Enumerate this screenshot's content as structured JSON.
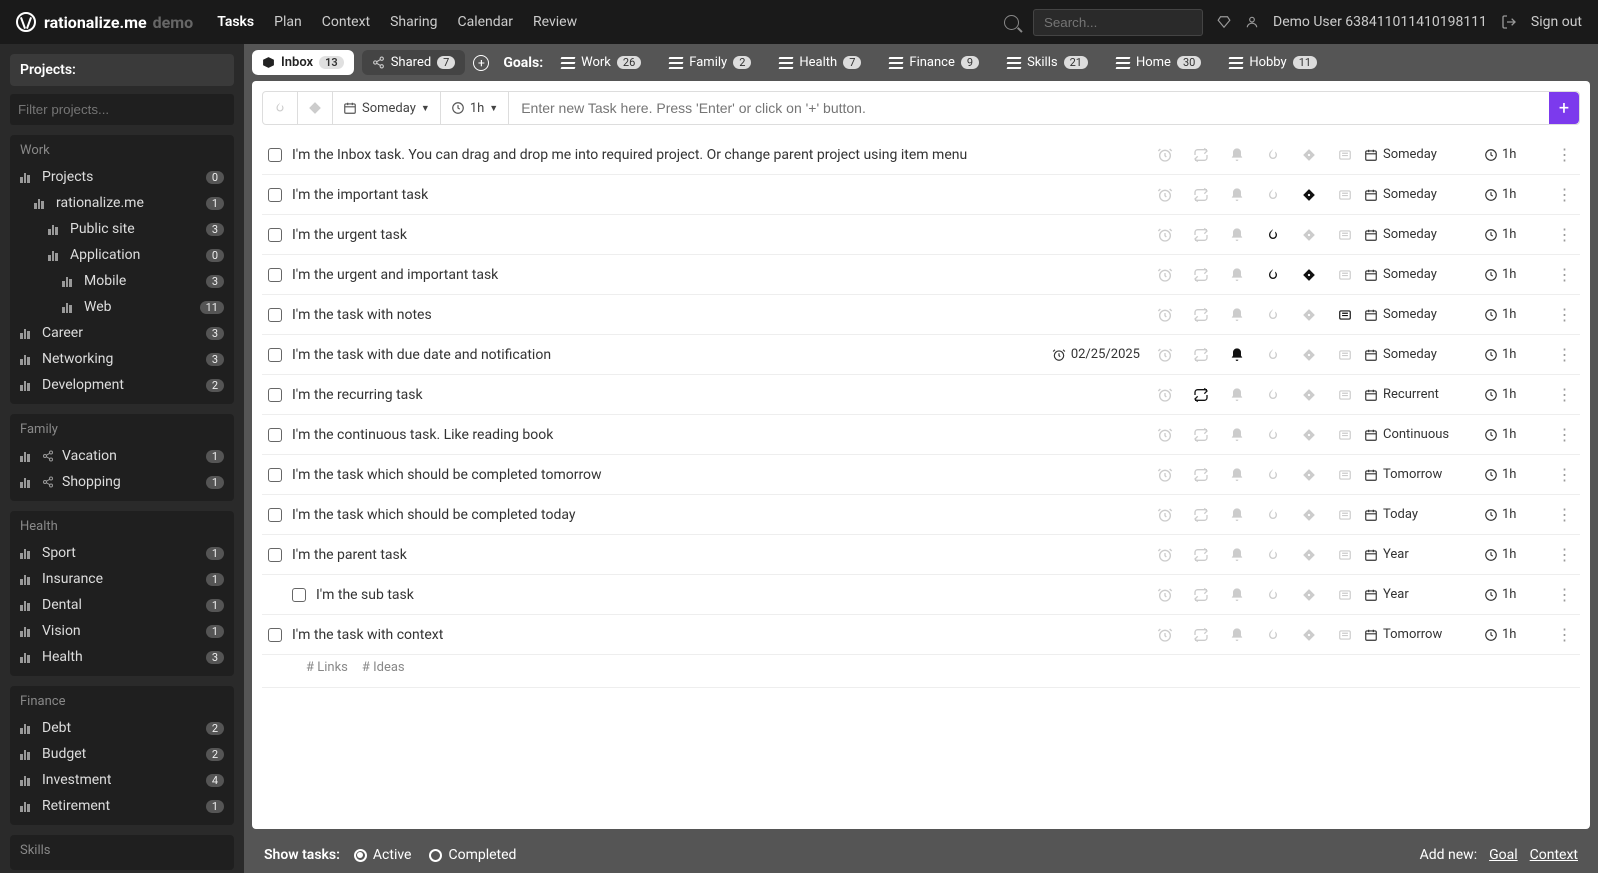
{
  "app": {
    "name": "rationalize.me",
    "mode": "demo"
  },
  "topnav": [
    {
      "label": "Tasks",
      "active": true
    },
    {
      "label": "Plan"
    },
    {
      "label": "Context"
    },
    {
      "label": "Sharing"
    },
    {
      "label": "Calendar"
    },
    {
      "label": "Review"
    }
  ],
  "search": {
    "placeholder": "Search..."
  },
  "user": {
    "name": "Demo User 638411011410198111",
    "signout": "Sign out"
  },
  "sidebar": {
    "title": "Projects:",
    "filter_placeholder": "Filter projects...",
    "groups": [
      {
        "title": "Work",
        "items": [
          {
            "label": "Projects",
            "count": 0,
            "indent": 0
          },
          {
            "label": "rationalize.me",
            "count": 1,
            "indent": 1
          },
          {
            "label": "Public site",
            "count": 3,
            "indent": 2
          },
          {
            "label": "Application",
            "count": 0,
            "indent": 2
          },
          {
            "label": "Mobile",
            "count": 3,
            "indent": 3
          },
          {
            "label": "Web",
            "count": 11,
            "indent": 3
          },
          {
            "label": "Career",
            "count": 3,
            "indent": 0
          },
          {
            "label": "Networking",
            "count": 3,
            "indent": 0
          },
          {
            "label": "Development",
            "count": 2,
            "indent": 0
          }
        ]
      },
      {
        "title": "Family",
        "items": [
          {
            "label": "Vacation",
            "count": 1,
            "indent": 0,
            "share": true
          },
          {
            "label": "Shopping",
            "count": 1,
            "indent": 0,
            "share": true
          }
        ]
      },
      {
        "title": "Health",
        "items": [
          {
            "label": "Sport",
            "count": 1,
            "indent": 0
          },
          {
            "label": "Insurance",
            "count": 1,
            "indent": 0
          },
          {
            "label": "Dental",
            "count": 1,
            "indent": 0
          },
          {
            "label": "Vision",
            "count": 1,
            "indent": 0
          },
          {
            "label": "Health",
            "count": 3,
            "indent": 0
          }
        ]
      },
      {
        "title": "Finance",
        "items": [
          {
            "label": "Debt",
            "count": 2,
            "indent": 0
          },
          {
            "label": "Budget",
            "count": 2,
            "indent": 0
          },
          {
            "label": "Investment",
            "count": 4,
            "indent": 0
          },
          {
            "label": "Retirement",
            "count": 1,
            "indent": 0
          }
        ]
      },
      {
        "title": "Skills",
        "items": []
      }
    ]
  },
  "tabs": {
    "inbox": {
      "label": "Inbox",
      "count": 13
    },
    "shared": {
      "label": "Shared",
      "count": 7
    }
  },
  "goals": {
    "label": "Goals:",
    "items": [
      {
        "label": "Work",
        "count": 26
      },
      {
        "label": "Family",
        "count": 2
      },
      {
        "label": "Health",
        "count": 7
      },
      {
        "label": "Finance",
        "count": 9
      },
      {
        "label": "Skills",
        "count": 21
      },
      {
        "label": "Home",
        "count": 30
      },
      {
        "label": "Hobby",
        "count": 11
      }
    ]
  },
  "toolbar": {
    "schedule": "Someday",
    "duration": "1h",
    "placeholder": "Enter new Task here. Press 'Enter' or click on '+' button."
  },
  "tasks": [
    {
      "title": "I'm the Inbox task. You can drag and drop me into required project. Or change parent project using item menu",
      "schedule": "Someday",
      "duration": "1h"
    },
    {
      "title": "I'm the important task",
      "schedule": "Someday",
      "duration": "1h",
      "important": true
    },
    {
      "title": "I'm the urgent task",
      "schedule": "Someday",
      "duration": "1h",
      "urgent": true
    },
    {
      "title": "I'm the urgent and important task",
      "schedule": "Someday",
      "duration": "1h",
      "urgent": true,
      "important": true
    },
    {
      "title": "I'm the task with notes",
      "schedule": "Someday",
      "duration": "1h",
      "notes": true
    },
    {
      "title": "I'm the task with due date and notification",
      "schedule": "Someday",
      "duration": "1h",
      "due": "02/25/2025",
      "notify": true
    },
    {
      "title": "I'm the recurring task",
      "schedule": "Recurrent",
      "duration": "1h",
      "recur": true
    },
    {
      "title": "I'm the continuous task. Like reading book",
      "schedule": "Continuous",
      "duration": "1h"
    },
    {
      "title": "I'm the task which should be completed tomorrow",
      "schedule": "Tomorrow",
      "duration": "1h"
    },
    {
      "title": "I'm the task which should be completed today",
      "schedule": "Today",
      "duration": "1h"
    },
    {
      "title": "I'm the parent task",
      "schedule": "Year",
      "duration": "1h"
    },
    {
      "title": "I'm the sub task",
      "schedule": "Year",
      "duration": "1h",
      "sub": true
    },
    {
      "title": "I'm the task with context",
      "schedule": "Tomorrow",
      "duration": "1h",
      "tags": [
        "# Links",
        "# Ideas"
      ]
    }
  ],
  "footer": {
    "show_label": "Show tasks:",
    "active": "Active",
    "completed": "Completed",
    "addnew": "Add new:",
    "goal": "Goal",
    "context": "Context"
  }
}
